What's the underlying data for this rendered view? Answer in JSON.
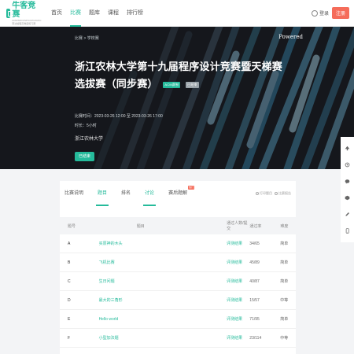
{
  "nav": {
    "logo_text": "牛客竞赛",
    "logo_sub": "ACM/NOI/CSP/CCPC/ICPC算法编程高难度练习赛",
    "links": [
      "首页",
      "比赛",
      "题库",
      "课程",
      "排行榜"
    ],
    "active_index": 1,
    "login_label": "登录",
    "signup_label": "注册"
  },
  "banner": {
    "breadcrumb": "比赛 > 学校赛",
    "powered": "Powered",
    "title": "浙江农林大学第十九届程序设计竞赛暨天梯赛选拔赛（同步赛）",
    "tags": [
      "ACM赛制",
      "已结束"
    ],
    "time": "比赛时间：2023-03-26 12:00 至 2023-03-26 17:00",
    "duration": "时长：5小时",
    "organizer": "浙江农林大学",
    "enroll_label": "已结束"
  },
  "tabs": {
    "items": [
      "比赛说明",
      "题目",
      "排名",
      "讨论",
      "赛后题解"
    ],
    "active_index": 1,
    "hot_label": "热门",
    "actions": [
      "打印题目",
      "比赛报告"
    ]
  },
  "table": {
    "headers": [
      "题号",
      "题目",
      "通过人数/提交",
      "通过率",
      "难度"
    ],
    "rows": [
      {
        "id": "A",
        "title": "买原神的木头",
        "judge": "评测结果",
        "rate": "34/65",
        "diff": "简单"
      },
      {
        "id": "B",
        "title": "飞机比赛",
        "judge": "评测结果",
        "rate": "45/89",
        "diff": "简单"
      },
      {
        "id": "C",
        "title": "生日问题",
        "judge": "评测结果",
        "rate": "40/87",
        "diff": "简单"
      },
      {
        "id": "D",
        "title": "最大的三角形",
        "judge": "评测结果",
        "rate": "15/57",
        "diff": "中等"
      },
      {
        "id": "E",
        "title": "Hello world",
        "judge": "评测结果",
        "rate": "71/95",
        "diff": "简单"
      },
      {
        "id": "F",
        "title": "小型加法题",
        "judge": "评测结果",
        "rate": "23/114",
        "diff": "中等"
      }
    ]
  },
  "sidebar": {
    "icons": [
      "top-icon",
      "app-icon",
      "wechat-icon",
      "feedback-icon",
      "edit-icon",
      "phone-icon"
    ]
  },
  "colors": {
    "brand": "#25bb9b",
    "accent_red": "#f56c5a",
    "banner_bg": "#15171c"
  }
}
